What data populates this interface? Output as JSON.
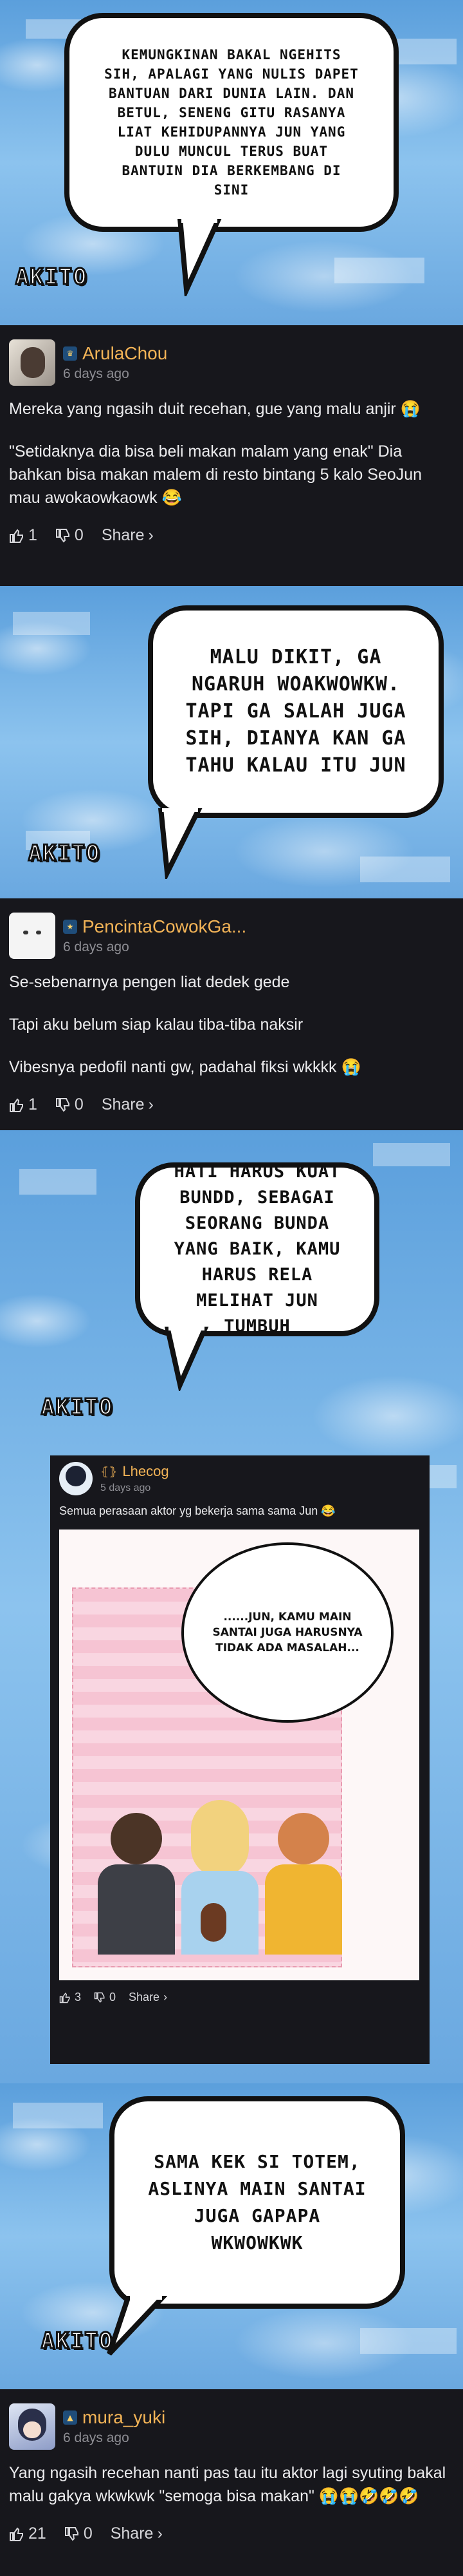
{
  "panels": [
    {
      "bubble_text": "KEMUNGKINAN BAKAL NGEHITS SIH, APALAGI YANG NULIS DAPET BANTUAN DARI DUNIA LAIN. DAN BETUL, SENENG GITU RASANYA LIAT KEHIDUPANNYA JUN YANG DULU MUNCUL TERUS BUAT BANTUIN DIA BERKEMBANG DI SINI",
      "watermark": "AKITO"
    },
    {
      "bubble_text": "MALU DIKIT, GA NGARUH WOAKWOWKW. TAPI GA SALAH JUGA SIH, DIANYA KAN GA TAHU KALAU ITU JUN",
      "watermark": "AKITO"
    },
    {
      "bubble_text": "HATI HARUS KUAT BUNDD, SEBAGAI SEORANG BUNDA YANG BAIK, KAMU HARUS RELA MELIHAT JUN TUMBUH",
      "watermark": "AKITO"
    },
    {
      "bubble_text": "SAMA KEK SI TOTEM, ASLINYA MAIN SANTAI JUGA GAPAPA WKWOWKWK",
      "watermark": "AKITO"
    }
  ],
  "comments": [
    {
      "username": "ArulaChou",
      "time": "6 days ago",
      "lines": [
        "Mereka yang ngasih duit recehan, gue yang malu anjir 😭",
        "\"Setidaknya dia bisa beli makan malam yang enak\" Dia bahkan bisa makan malem di resto bintang 5 kalo SeoJun mau awokaowkaowk 😂"
      ],
      "likes": "1",
      "dislikes": "0",
      "share_label": "Share"
    },
    {
      "username": "PencintaCowokGa...",
      "time": "6 days ago",
      "lines": [
        "Se-sebenarnya pengen liat dedek gede",
        "Tapi aku belum siap kalau tiba-tiba naksir",
        "Vibesnya pedofil nanti gw, padahal fiksi wkkkk 😭"
      ],
      "likes": "1",
      "dislikes": "0",
      "share_label": "Share"
    },
    {
      "username": "mura_yuki",
      "time": "6 days ago",
      "lines": [
        "Yang ngasih recehan nanti pas tau itu aktor lagi syuting bakal malu gakya wkwkwk \"semoga bisa makan\" 😭😭🤣🤣🤣"
      ],
      "likes": "21",
      "dislikes": "0",
      "share_label": "Share"
    }
  ],
  "embedded": {
    "username": "Lhecog",
    "time": "5 days ago",
    "text": "Semua perasaan aktor yg bekerja sama sama Jun 😂",
    "manga_bubble": "......JUN, KAMU MAIN SANTAI JUGA HARUSNYA TIDAK ADA MASALAH...",
    "likes": "3",
    "dislikes": "0",
    "share_label": "Share"
  },
  "icons": {
    "like": "thumbs-up-icon",
    "dislike": "thumbs-down-icon",
    "share": "chevron-right-icon",
    "badge": "rank-badge-icon"
  },
  "colors": {
    "username": "#f3b457",
    "card_bg": "#17171c",
    "sky": "#7fb8e8",
    "time": "#8d8d93"
  }
}
